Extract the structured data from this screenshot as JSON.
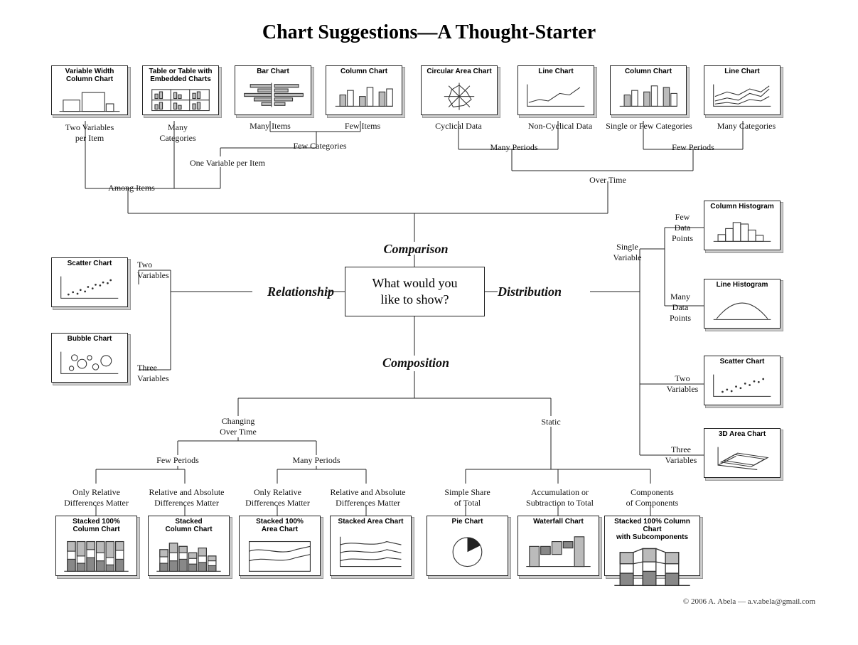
{
  "title": "Chart Suggestions—A Thought-Starter",
  "center": "What would you\nlike to show?",
  "copyright": "© 2006  A. Abela — a.v.abela@gmail.com",
  "branches": {
    "comparison": "Comparison",
    "relationship": "Relationship",
    "distribution": "Distribution",
    "composition": "Composition"
  },
  "labels": {
    "two_vars_per_item": "Two Variables\nper Item",
    "many_categories_top": "Many\nCategories",
    "one_var_per_item": "One Variable per Item",
    "among_items": "Among Items",
    "many_items": "Many Items",
    "few_items": "Few Items",
    "few_categories": "Few Categories",
    "cyclical": "Cyclical Data",
    "noncyclical": "Non-Cyclical Data",
    "many_periods_top": "Many Periods",
    "single_or_few_cat": "Single or Few Categories",
    "many_categories_right": "Many Categories",
    "few_periods_top": "Few Periods",
    "over_time": "Over Time",
    "two_variables": "Two\nVariables",
    "three_variables": "Three\nVariables",
    "changing_over_time": "Changing\nOver Time",
    "static": "Static",
    "few_periods_bot": "Few Periods",
    "many_periods_bot": "Many Periods",
    "only_rel_1": "Only Relative\nDifferences Matter",
    "rel_abs_1": "Relative and Absolute\nDifferences Matter",
    "only_rel_2": "Only Relative\nDifferences Matter",
    "rel_abs_2": "Relative and Absolute\nDifferences Matter",
    "simple_share": "Simple Share\nof Total",
    "accum_sub": "Accumulation or\nSubtraction to Total",
    "components": "Components\nof Components",
    "single_variable": "Single\nVariable",
    "few_data_points": "Few\nData\nPoints",
    "many_data_points": "Many\nData\nPoints",
    "two_variables_r": "Two\nVariables",
    "three_variables_r": "Three\nVariables"
  },
  "cards": {
    "var_width_col": "Variable Width\nColumn Chart",
    "table_embedded": "Table or Table with\nEmbedded Charts",
    "bar_chart": "Bar Chart",
    "column_chart_top": "Column Chart",
    "circular_area": "Circular Area Chart",
    "line_chart_top": "Line Chart",
    "column_chart_right": "Column Chart",
    "line_chart_right": "Line Chart",
    "scatter_chart": "Scatter Chart",
    "bubble_chart": "Bubble Chart",
    "column_histogram": "Column Histogram",
    "line_histogram": "Line Histogram",
    "scatter_chart_r": "Scatter Chart",
    "area_3d": "3D Area Chart",
    "stacked_100_col": "Stacked 100%\nColumn Chart",
    "stacked_col": "Stacked\nColumn Chart",
    "stacked_100_area": "Stacked 100%\nArea Chart",
    "stacked_area": "Stacked Area Chart",
    "pie_chart": "Pie Chart",
    "waterfall": "Waterfall Chart",
    "stacked_100_sub": "Stacked 100% Column Chart\nwith Subcomponents"
  }
}
